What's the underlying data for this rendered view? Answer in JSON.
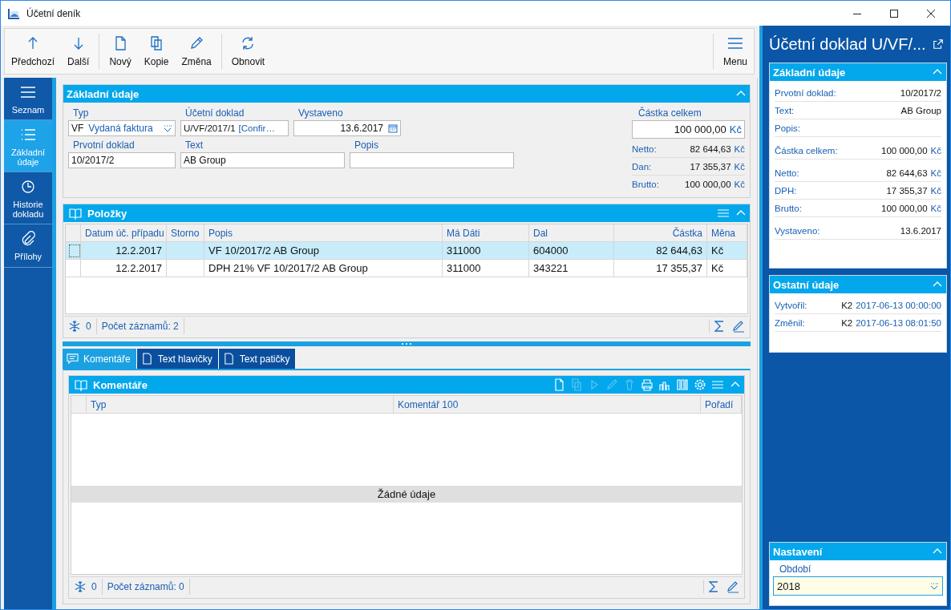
{
  "window": {
    "title": "Účetní deník"
  },
  "toolbar": {
    "groups": [
      [
        {
          "label": "Předchozí"
        },
        {
          "label": "Další"
        }
      ],
      [
        {
          "label": "Nový"
        },
        {
          "label": "Kopie"
        },
        {
          "label": "Změna"
        }
      ],
      [
        {
          "label": "Obnovit"
        }
      ]
    ],
    "menu": {
      "label": "Menu"
    }
  },
  "nav": [
    {
      "label": "Seznam",
      "selected": false
    },
    {
      "label": "Základní údaje",
      "selected": true
    },
    {
      "label": "Historie dokladu",
      "selected": false
    },
    {
      "label": "Přílohy",
      "selected": false
    }
  ],
  "basic": {
    "title": "Základní údaje",
    "rows": [
      [
        {
          "kind": "combo",
          "label": "Typ",
          "code": "VF",
          "text": "Vydaná faktura"
        },
        {
          "kind": "ref",
          "label": "Účetní doklad",
          "value": "U/VF/2017/1",
          "note": "[Confir…"
        },
        {
          "kind": "date",
          "label": "Vystaveno",
          "value": "13.6.2017"
        }
      ],
      [
        {
          "kind": "text",
          "label": "Prvotní doklad",
          "value": "10/2017/2"
        },
        {
          "kind": "wide",
          "label": "Text",
          "value": "AB Group"
        },
        {
          "kind": "wide",
          "label": "Popis"
        }
      ]
    ],
    "total": {
      "label": "Částka celkem",
      "value": "100 000,00",
      "currency": "Kč"
    },
    "summary": [
      {
        "label": "Netto:",
        "value": "82 644,63",
        "currency": "Kč"
      },
      {
        "label": "Dan:",
        "value": "17 355,37",
        "currency": "Kč"
      },
      {
        "label": "Brutto:",
        "value": "100 000,00",
        "currency": "Kč"
      }
    ]
  },
  "items": {
    "title": "Položky",
    "columns": [
      "Datum úč. případu",
      "Storno",
      "Popis",
      "Má Dáti",
      "Dal",
      "Částka",
      "Měna"
    ],
    "rows": [
      {
        "selected": true,
        "date": "12.2.2017",
        "description": "VF 10/2017/2 AB Group",
        "debit": "311000",
        "credit": "604000",
        "amount": "82 644,63",
        "currency": "Kč"
      },
      {
        "selected": false,
        "date": "12.2.2017",
        "description": "DPH 21% VF 10/2017/2 AB Group",
        "debit": "311000",
        "credit": "343221",
        "amount": "17 355,37",
        "currency": "Kč"
      }
    ],
    "footer": {
      "count": "0",
      "records": "Počet záznamů: 2"
    }
  },
  "tabs": [
    {
      "label": "Komentáře",
      "selected": true
    },
    {
      "label": "Text hlavičky",
      "selected": false
    },
    {
      "label": "Text patičky",
      "selected": false
    }
  ],
  "comments": {
    "title": "Komentáře",
    "tools": [
      {
        "disabled": false
      },
      {
        "disabled": true
      },
      {
        "disabled": true
      },
      {
        "disabled": true
      },
      {
        "disabled": true
      },
      {
        "disabled": false
      },
      {
        "disabled": false
      },
      {
        "disabled": false
      },
      {
        "disabled": false
      }
    ],
    "columns": [
      "Typ",
      "Komentář 100",
      "Pořadí"
    ],
    "empty": "Žádné údaje",
    "footer": {
      "count": "0",
      "records": "Počet záznamů: 0"
    }
  },
  "side": {
    "title": "Účetní doklad U/VF/...",
    "basic": {
      "title": "Základní údaje",
      "rows": [
        {
          "label": "Prvotní doklad:",
          "value": "10/2017/2"
        },
        {
          "label": "Text:",
          "value": "AB Group"
        },
        {
          "label": "Popis:"
        },
        {
          "label": "Částka celkem:",
          "value": "100 000,00",
          "currency": "Kč"
        },
        {
          "label": "Netto:",
          "value": "82 644,63",
          "currency": "Kč"
        },
        {
          "label": "DPH:",
          "value": "17 355,37",
          "currency": "Kč"
        },
        {
          "label": "Brutto:",
          "value": "100 000,00",
          "currency": "Kč"
        },
        {
          "label": "Vystaveno:",
          "value": "13.6.2017"
        }
      ]
    },
    "other": {
      "title": "Ostatní údaje",
      "rows": [
        {
          "label": "Vytvořil:",
          "user": "K2",
          "date": "2017-06-13 00:00:00"
        },
        {
          "label": "Změnil:",
          "user": "K2",
          "date": "2017-06-13 08:01:50"
        }
      ]
    },
    "settings": {
      "title": "Nastavení",
      "label": "Období",
      "value": "2018"
    }
  }
}
